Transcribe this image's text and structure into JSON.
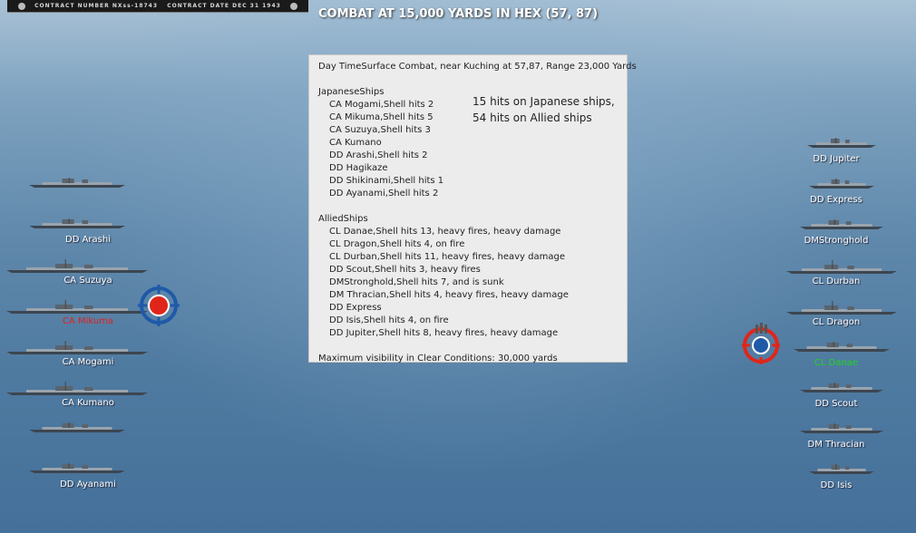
{
  "header": {
    "plate_left": "CONTRACT NUMBER  NXss-18743",
    "plate_right": "CONTRACT DATE  DEC 31 1943",
    "title": "COMBAT AT 15,000 YARDS IN HEX (57, 87)"
  },
  "report": {
    "headline": "Day TimeSurface Combat, near Kuching at 57,87, Range 23,000 Yards",
    "japanese_heading": "JapaneseShips",
    "japanese": [
      "CA Mogami,Shell hits 2",
      "CA Mikuma,Shell hits 5",
      "CA Suzuya,Shell hits 3",
      "CA Kumano",
      "DD Arashi,Shell hits 2",
      "DD Hagikaze",
      "DD Shikinami,Shell hits 1",
      "DD Ayanami,Shell hits 2"
    ],
    "allied_heading": "AlliedShips",
    "allied": [
      "CL Danae,Shell hits 13,  heavy fires,  heavy damage",
      "CL Dragon,Shell hits 4,  on fire",
      "CL Durban,Shell hits 11,  heavy fires,  heavy damage",
      "DD Scout,Shell hits 3,  heavy fires",
      "DMStronghold,Shell hits 7, and is sunk",
      "DM Thracian,Shell hits 4,  heavy fires,  heavy damage",
      "DD Express",
      "DD Isis,Shell hits 4,  on fire",
      "DD Jupiter,Shell hits 8,  heavy fires,  heavy damage"
    ],
    "visibility": "Maximum visibility in Clear Conditions: 30,000 yards",
    "summary_line1": "15 hits on Japanese ships,",
    "summary_line2": "54 hits on Allied ships"
  },
  "left_ships": [
    {
      "label": "",
      "style": "normal"
    },
    {
      "label": "DD Arashi",
      "style": "normal"
    },
    {
      "label": "CA Suzuya",
      "style": "normal"
    },
    {
      "label": "CA Mikuma",
      "style": "red"
    },
    {
      "label": "CA Mogami",
      "style": "normal"
    },
    {
      "label": "CA Kumano",
      "style": "normal"
    },
    {
      "label": "",
      "style": "normal"
    },
    {
      "label": "DD Ayanami",
      "style": "normal"
    }
  ],
  "right_ships": [
    {
      "label": "DD Jupiter",
      "style": "normal"
    },
    {
      "label": "DD Express",
      "style": "normal"
    },
    {
      "label": "DMStronghold",
      "style": "normal"
    },
    {
      "label": "CL Durban",
      "style": "normal"
    },
    {
      "label": "CL Dragon",
      "style": "normal"
    },
    {
      "label": "CL Danae",
      "style": "green"
    },
    {
      "label": "DD Scout",
      "style": "normal"
    },
    {
      "label": "DM Thracian",
      "style": "normal"
    },
    {
      "label": "DD Isis",
      "style": "normal"
    }
  ],
  "colors": {
    "hull": "#3d4650",
    "deck": "#9aa4ad",
    "target_red": "#e0261a",
    "target_blue": "#1f5aa8"
  }
}
